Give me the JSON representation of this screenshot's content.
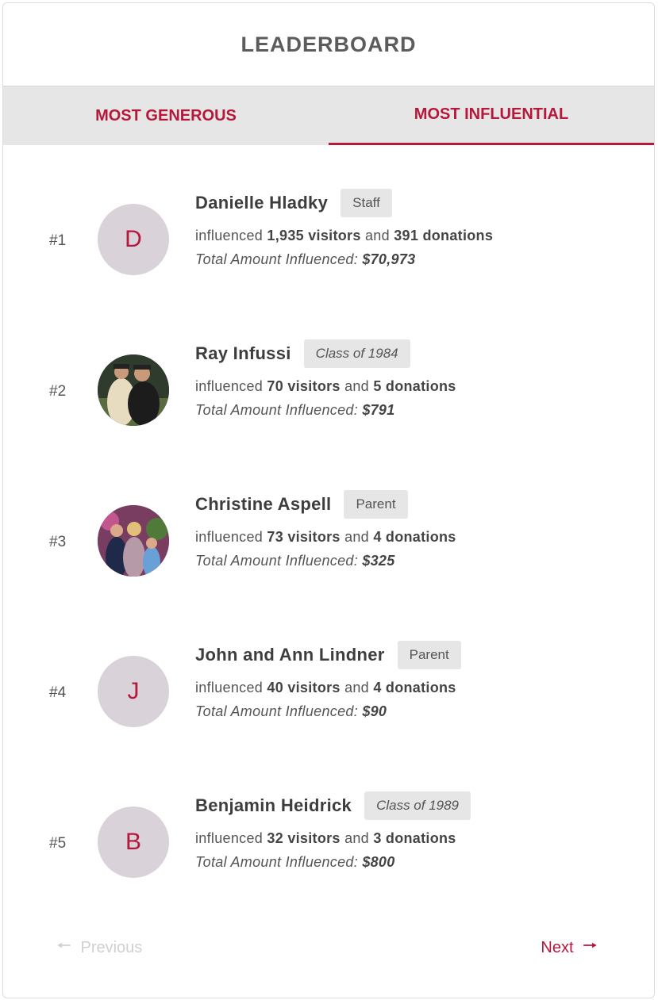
{
  "header": {
    "title": "LEADERBOARD"
  },
  "tabs": [
    {
      "label": "MOST GENEROUS",
      "active": false
    },
    {
      "label": "MOST INFLUENTIAL",
      "active": true
    }
  ],
  "entries": [
    {
      "rank": "#1",
      "initial": "D",
      "name": "Danielle Hladky",
      "badge": "Staff",
      "visitors": "1,935 visitors",
      "donations": "391 donations",
      "total": "$70,973"
    },
    {
      "rank": "#2",
      "initial": "",
      "name": "Ray Infussi",
      "badge": "Class of 1984",
      "visitors": "70 visitors",
      "donations": "5 donations",
      "total": "$791"
    },
    {
      "rank": "#3",
      "initial": "",
      "name": "Christine Aspell",
      "badge": "Parent",
      "visitors": "73 visitors",
      "donations": "4 donations",
      "total": "$325"
    },
    {
      "rank": "#4",
      "initial": "J",
      "name": "John and Ann Lindner",
      "badge": "Parent",
      "visitors": "40 visitors",
      "donations": "4 donations",
      "total": "$90"
    },
    {
      "rank": "#5",
      "initial": "B",
      "name": "Benjamin Heidrick",
      "badge": "Class of 1989",
      "visitors": "32 visitors",
      "donations": "3 donations",
      "total": "$800"
    }
  ],
  "labels": {
    "influenced": "influenced",
    "and": "and",
    "total_prefix": "Total Amount Influenced:"
  },
  "pager": {
    "previous": "Previous",
    "next": "Next"
  },
  "colors": {
    "accent": "#b5183b",
    "avatar_bg": "#d9d2d8",
    "tab_bg": "#e6e6e6"
  }
}
